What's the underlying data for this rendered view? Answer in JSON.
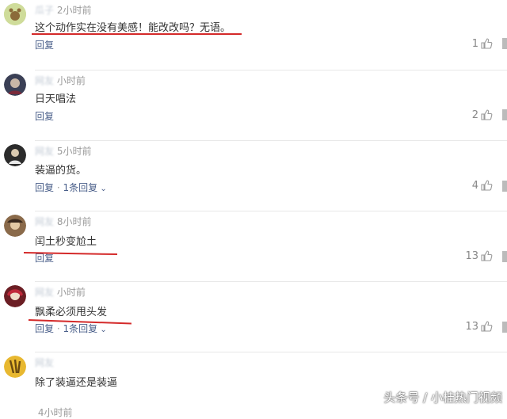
{
  "comments": [
    {
      "user": "瓜子",
      "time": "2小时前",
      "text": "这个动作实在没有美感！能改改吗？无语。",
      "reply_label": "回复",
      "likes": "1"
    },
    {
      "user": "网友",
      "time": "小时前",
      "text": "日天唱法",
      "reply_label": "回复",
      "likes": "2"
    },
    {
      "user": "网友",
      "time": "5小时前",
      "text": "装逼的货。",
      "reply_label": "回复",
      "replies_label": "1条回复",
      "likes": "4"
    },
    {
      "user": "网友",
      "time": "8小时前",
      "text": "闰土秒变尬土",
      "reply_label": "回复",
      "likes": "13"
    },
    {
      "user": "网友",
      "time": "小时前",
      "text": "飘柔必须甩头发",
      "reply_label": "回复",
      "replies_label": "1条回复",
      "likes": "13"
    },
    {
      "user": "网友",
      "time": "",
      "text": "除了装逼还是装逼",
      "reply_label": "",
      "likes": ""
    },
    {
      "user": "",
      "time": "4小时前",
      "text": "",
      "reply_label": "",
      "likes": ""
    }
  ],
  "watermark": "头条号 / 小桂热门视频",
  "colors": {
    "annotation_red": "#d42a2a",
    "link_blue": "#4a5f8a"
  },
  "icons": {
    "like": "thumbs-up-icon",
    "expand": "chevron-down-icon"
  }
}
